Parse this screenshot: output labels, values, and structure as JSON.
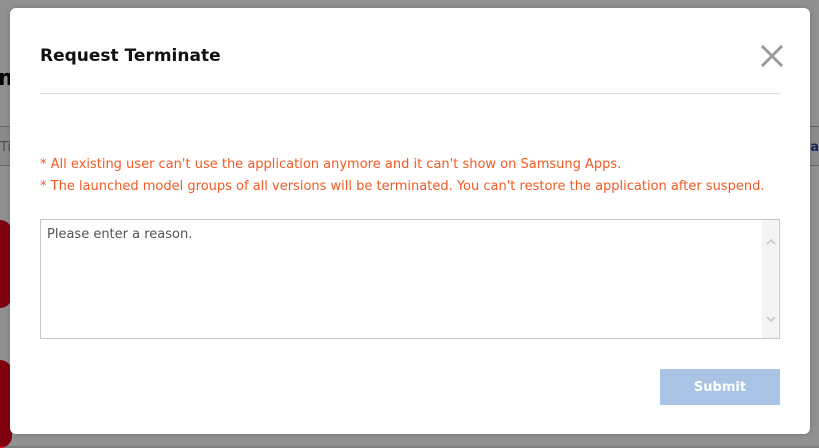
{
  "background": {
    "partial_heading": "m",
    "left_partial_text": "Ti",
    "right_partial_text": "ra"
  },
  "dialog": {
    "title": "Request Terminate",
    "close_icon": "close-icon",
    "warnings": [
      "* All existing user can't use the application anymore and it can't show on Samsung Apps.",
      "* The launched model groups of all versions will be terminated. You can't restore the application after suspend."
    ],
    "reason": {
      "placeholder": "Please enter a reason.",
      "value": ""
    },
    "submit_label": "Submit"
  },
  "colors": {
    "warning_text": "#f15a24",
    "submit_background": "#a9c3e4",
    "close_icon": "#9c9c9c"
  }
}
